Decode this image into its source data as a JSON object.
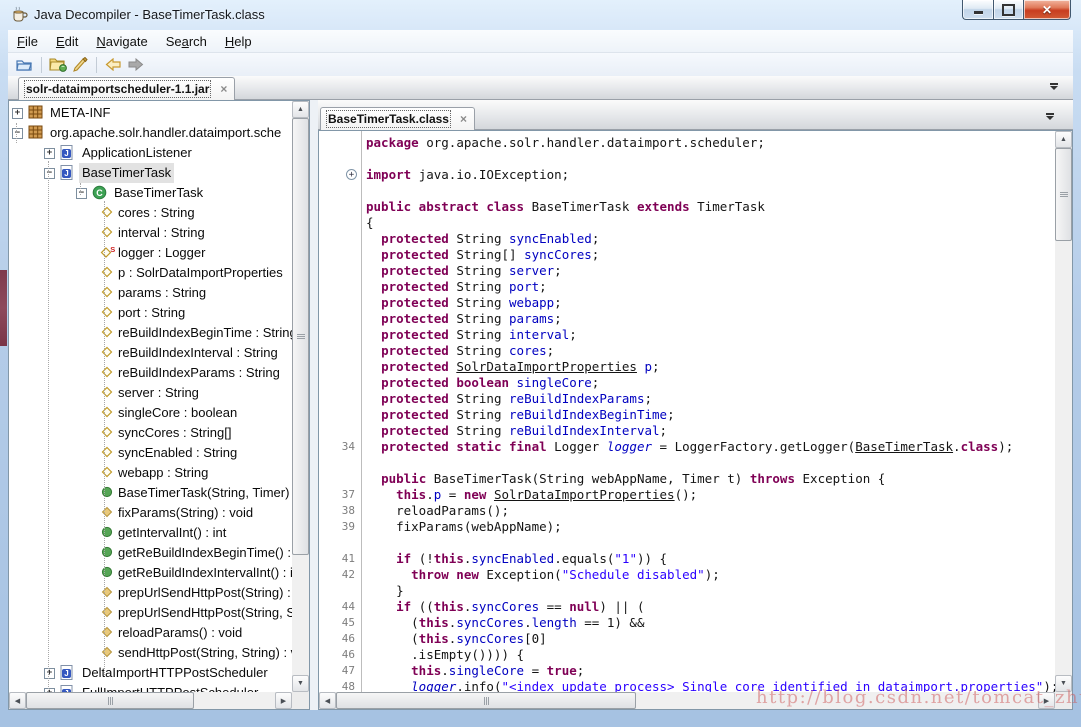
{
  "window": {
    "title": "Java Decompiler - BaseTimerTask.class"
  },
  "menu": {
    "items": [
      {
        "pre": "",
        "u": "F",
        "post": "ile"
      },
      {
        "pre": "",
        "u": "E",
        "post": "dit"
      },
      {
        "pre": "",
        "u": "N",
        "post": "avigate"
      },
      {
        "pre": "Se",
        "u": "a",
        "post": "rch"
      },
      {
        "pre": "",
        "u": "H",
        "post": "elp"
      }
    ]
  },
  "toolbar": {
    "icons": [
      "open-file-icon",
      "open-jar-icon",
      "search-brush-icon",
      "back-icon",
      "forward-icon"
    ]
  },
  "jar_tab": {
    "label": "solr-dataimportscheduler-1.1.jar",
    "close": "×"
  },
  "source_tab": {
    "label": "BaseTimerTask.class",
    "close": "×"
  },
  "tree": {
    "items": [
      {
        "indent": 0,
        "expander": "plus",
        "icon": "package",
        "label": "META-INF"
      },
      {
        "indent": 0,
        "expander": "minus",
        "icon": "package",
        "label": "org.apache.solr.handler.dataimport.sche"
      },
      {
        "indent": 1,
        "expander": "plus",
        "icon": "jclass",
        "label": "ApplicationListener"
      },
      {
        "indent": 1,
        "expander": "minus",
        "icon": "jclass",
        "label": "BaseTimerTask",
        "selected": true
      },
      {
        "indent": 2,
        "expander": "minus",
        "icon": "class",
        "label": "BaseTimerTask"
      },
      {
        "indent": 3,
        "icon": "field",
        "label": "cores : String"
      },
      {
        "indent": 3,
        "icon": "field",
        "label": "interval : String"
      },
      {
        "indent": 3,
        "icon": "field-static",
        "label": "logger : Logger"
      },
      {
        "indent": 3,
        "icon": "field",
        "label": "p : SolrDataImportProperties"
      },
      {
        "indent": 3,
        "icon": "field",
        "label": "params : String"
      },
      {
        "indent": 3,
        "icon": "field",
        "label": "port : String"
      },
      {
        "indent": 3,
        "icon": "field",
        "label": "reBuildIndexBeginTime : String"
      },
      {
        "indent": 3,
        "icon": "field",
        "label": "reBuildIndexInterval : String"
      },
      {
        "indent": 3,
        "icon": "field",
        "label": "reBuildIndexParams : String"
      },
      {
        "indent": 3,
        "icon": "field",
        "label": "server : String"
      },
      {
        "indent": 3,
        "icon": "field",
        "label": "singleCore : boolean"
      },
      {
        "indent": 3,
        "icon": "field",
        "label": "syncCores : String[]"
      },
      {
        "indent": 3,
        "icon": "field",
        "label": "syncEnabled : String"
      },
      {
        "indent": 3,
        "icon": "field",
        "label": "webapp : String"
      },
      {
        "indent": 3,
        "icon": "method-pub",
        "label": "BaseTimerTask(String, Timer)"
      },
      {
        "indent": 3,
        "icon": "method-prot",
        "label": "fixParams(String) : void"
      },
      {
        "indent": 3,
        "icon": "method-pub",
        "label": "getIntervalInt() : int"
      },
      {
        "indent": 3,
        "icon": "method-pub",
        "label": "getReBuildIndexBeginTime() : D"
      },
      {
        "indent": 3,
        "icon": "method-pub",
        "label": "getReBuildIndexIntervalInt() : ir"
      },
      {
        "indent": 3,
        "icon": "method-prot",
        "label": "prepUrlSendHttpPost(String) : v"
      },
      {
        "indent": 3,
        "icon": "method-prot",
        "label": "prepUrlSendHttpPost(String, St"
      },
      {
        "indent": 3,
        "icon": "method-prot",
        "label": "reloadParams() : void"
      },
      {
        "indent": 3,
        "icon": "method-prot",
        "label": "sendHttpPost(String, String) : v"
      },
      {
        "indent": 1,
        "expander": "plus",
        "icon": "jclass",
        "label": "DeltaImportHTTPPostScheduler"
      },
      {
        "indent": 1,
        "expander": "plus",
        "icon": "jclass",
        "label": "FullImportHTTPPostScheduler"
      }
    ]
  },
  "code": {
    "lines": [
      {
        "num": "",
        "segs": [
          [
            "k",
            "package "
          ],
          [
            "p",
            "org.apache.solr.handler.dataimport.scheduler;"
          ]
        ]
      },
      {
        "num": "",
        "segs": []
      },
      {
        "num": "",
        "fold": true,
        "segs": [
          [
            "k",
            "import "
          ],
          [
            "p",
            "java.io.IOException;"
          ]
        ]
      },
      {
        "num": "",
        "segs": []
      },
      {
        "num": "",
        "segs": [
          [
            "k",
            "public abstract class "
          ],
          [
            "p",
            "BaseTimerTask "
          ],
          [
            "k",
            "extends "
          ],
          [
            "p",
            "TimerTask"
          ]
        ]
      },
      {
        "num": "",
        "segs": [
          [
            "p",
            "{"
          ]
        ]
      },
      {
        "num": "",
        "segs": [
          [
            "p",
            "  "
          ],
          [
            "k",
            "protected "
          ],
          [
            "p",
            "String "
          ],
          [
            "f",
            "syncEnabled"
          ],
          [
            "p",
            ";"
          ]
        ]
      },
      {
        "num": "",
        "segs": [
          [
            "p",
            "  "
          ],
          [
            "k",
            "protected "
          ],
          [
            "p",
            "String[] "
          ],
          [
            "f",
            "syncCores"
          ],
          [
            "p",
            ";"
          ]
        ]
      },
      {
        "num": "",
        "segs": [
          [
            "p",
            "  "
          ],
          [
            "k",
            "protected "
          ],
          [
            "p",
            "String "
          ],
          [
            "f",
            "server"
          ],
          [
            "p",
            ";"
          ]
        ]
      },
      {
        "num": "",
        "segs": [
          [
            "p",
            "  "
          ],
          [
            "k",
            "protected "
          ],
          [
            "p",
            "String "
          ],
          [
            "f",
            "port"
          ],
          [
            "p",
            ";"
          ]
        ]
      },
      {
        "num": "",
        "segs": [
          [
            "p",
            "  "
          ],
          [
            "k",
            "protected "
          ],
          [
            "p",
            "String "
          ],
          [
            "f",
            "webapp"
          ],
          [
            "p",
            ";"
          ]
        ]
      },
      {
        "num": "",
        "segs": [
          [
            "p",
            "  "
          ],
          [
            "k",
            "protected "
          ],
          [
            "p",
            "String "
          ],
          [
            "f",
            "params"
          ],
          [
            "p",
            ";"
          ]
        ]
      },
      {
        "num": "",
        "segs": [
          [
            "p",
            "  "
          ],
          [
            "k",
            "protected "
          ],
          [
            "p",
            "String "
          ],
          [
            "f",
            "interval"
          ],
          [
            "p",
            ";"
          ]
        ]
      },
      {
        "num": "",
        "segs": [
          [
            "p",
            "  "
          ],
          [
            "k",
            "protected "
          ],
          [
            "p",
            "String "
          ],
          [
            "f",
            "cores"
          ],
          [
            "p",
            ";"
          ]
        ]
      },
      {
        "num": "",
        "segs": [
          [
            "p",
            "  "
          ],
          [
            "k",
            "protected "
          ],
          [
            "u",
            "SolrDataImportProperties"
          ],
          [
            "p",
            " "
          ],
          [
            "f",
            "p"
          ],
          [
            "p",
            ";"
          ]
        ]
      },
      {
        "num": "",
        "segs": [
          [
            "p",
            "  "
          ],
          [
            "k",
            "protected boolean "
          ],
          [
            "f",
            "singleCore"
          ],
          [
            "p",
            ";"
          ]
        ]
      },
      {
        "num": "",
        "segs": [
          [
            "p",
            "  "
          ],
          [
            "k",
            "protected "
          ],
          [
            "p",
            "String "
          ],
          [
            "f",
            "reBuildIndexParams"
          ],
          [
            "p",
            ";"
          ]
        ]
      },
      {
        "num": "",
        "segs": [
          [
            "p",
            "  "
          ],
          [
            "k",
            "protected "
          ],
          [
            "p",
            "String "
          ],
          [
            "f",
            "reBuildIndexBeginTime"
          ],
          [
            "p",
            ";"
          ]
        ]
      },
      {
        "num": "",
        "segs": [
          [
            "p",
            "  "
          ],
          [
            "k",
            "protected "
          ],
          [
            "p",
            "String "
          ],
          [
            "f",
            "reBuildIndexInterval"
          ],
          [
            "p",
            ";"
          ]
        ]
      },
      {
        "num": "34",
        "segs": [
          [
            "p",
            "  "
          ],
          [
            "k",
            "protected static final "
          ],
          [
            "p",
            "Logger "
          ],
          [
            "i",
            "logger"
          ],
          [
            "p",
            " = LoggerFactory.getLogger("
          ],
          [
            "u",
            "BaseTimerTask"
          ],
          [
            "p",
            "."
          ],
          [
            "k",
            "class"
          ],
          [
            "p",
            ");"
          ]
        ]
      },
      {
        "num": "",
        "segs": []
      },
      {
        "num": "",
        "segs": [
          [
            "p",
            "  "
          ],
          [
            "k",
            "public "
          ],
          [
            "p",
            "BaseTimerTask(String webAppName, Timer t) "
          ],
          [
            "k",
            "throws "
          ],
          [
            "p",
            "Exception {"
          ]
        ]
      },
      {
        "num": "37",
        "segs": [
          [
            "p",
            "    "
          ],
          [
            "k",
            "this"
          ],
          [
            "p",
            "."
          ],
          [
            "f",
            "p"
          ],
          [
            "p",
            " = "
          ],
          [
            "k",
            "new "
          ],
          [
            "u",
            "SolrDataImportProperties"
          ],
          [
            "p",
            "();"
          ]
        ]
      },
      {
        "num": "38",
        "segs": [
          [
            "p",
            "    reloadParams();"
          ]
        ]
      },
      {
        "num": "39",
        "segs": [
          [
            "p",
            "    fixParams(webAppName);"
          ]
        ]
      },
      {
        "num": "",
        "segs": []
      },
      {
        "num": "41",
        "segs": [
          [
            "p",
            "    "
          ],
          [
            "k",
            "if "
          ],
          [
            "p",
            "(!"
          ],
          [
            "k",
            "this"
          ],
          [
            "p",
            "."
          ],
          [
            "f",
            "syncEnabled"
          ],
          [
            "p",
            ".equals("
          ],
          [
            "s",
            "\"1\""
          ],
          [
            "p",
            ")) {"
          ]
        ]
      },
      {
        "num": "42",
        "segs": [
          [
            "p",
            "      "
          ],
          [
            "k",
            "throw new "
          ],
          [
            "p",
            "Exception("
          ],
          [
            "s",
            "\"Schedule disabled\""
          ],
          [
            "p",
            ");"
          ]
        ]
      },
      {
        "num": "",
        "segs": [
          [
            "p",
            "    }"
          ]
        ]
      },
      {
        "num": "44",
        "segs": [
          [
            "p",
            "    "
          ],
          [
            "k",
            "if "
          ],
          [
            "p",
            "(("
          ],
          [
            "k",
            "this"
          ],
          [
            "p",
            "."
          ],
          [
            "f",
            "syncCores"
          ],
          [
            "p",
            " == "
          ],
          [
            "k",
            "null"
          ],
          [
            "p",
            ") || ("
          ]
        ]
      },
      {
        "num": "45",
        "segs": [
          [
            "p",
            "      ("
          ],
          [
            "k",
            "this"
          ],
          [
            "p",
            "."
          ],
          [
            "f",
            "syncCores"
          ],
          [
            "p",
            "."
          ],
          [
            "f",
            "length"
          ],
          [
            "p",
            " == 1) && "
          ]
        ]
      },
      {
        "num": "46",
        "segs": [
          [
            "p",
            "      ("
          ],
          [
            "k",
            "this"
          ],
          [
            "p",
            "."
          ],
          [
            "f",
            "syncCores"
          ],
          [
            "p",
            "[0]"
          ]
        ]
      },
      {
        "num": "46",
        "segs": [
          [
            "p",
            "      .isEmpty()))) {"
          ]
        ]
      },
      {
        "num": "47",
        "segs": [
          [
            "p",
            "      "
          ],
          [
            "k",
            "this"
          ],
          [
            "p",
            "."
          ],
          [
            "f",
            "singleCore"
          ],
          [
            "p",
            " = "
          ],
          [
            "k",
            "true"
          ],
          [
            "p",
            ";"
          ]
        ]
      },
      {
        "num": "48",
        "segs": [
          [
            "p",
            "      "
          ],
          [
            "i",
            "logger"
          ],
          [
            "p",
            ".info("
          ],
          [
            "s",
            "\"<index update process> Single core identified in dataimport.properties\""
          ],
          [
            "p",
            ");"
          ]
        ]
      }
    ]
  },
  "watermark": {
    "text": "http://blog.csdn.net/tomcat_zhu"
  },
  "colors": {
    "keyword": "#7f0055",
    "field": "#0000c0",
    "string": "#2a00ff",
    "selection_bg": "#e2e2e2",
    "close_button": "#c83d20",
    "watermark": "#cd5555"
  }
}
